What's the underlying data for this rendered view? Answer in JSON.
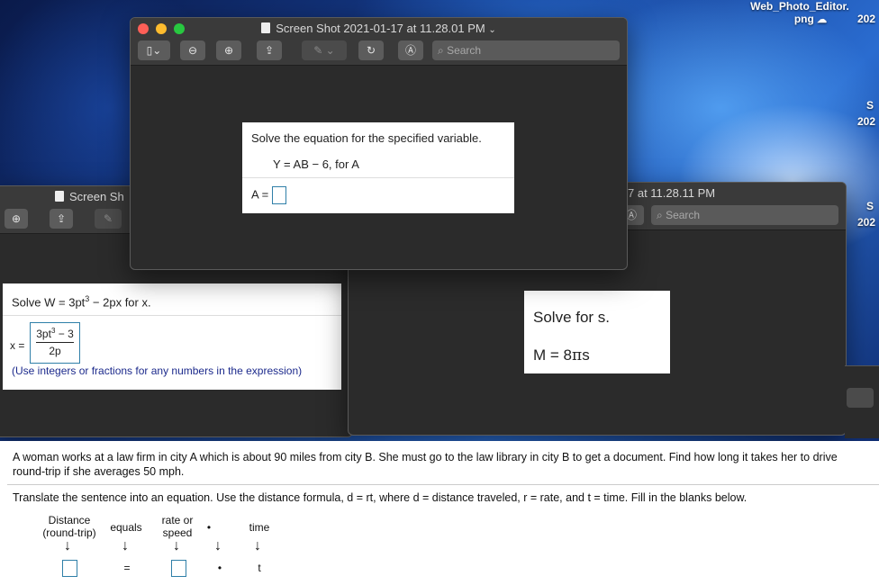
{
  "desktop": {
    "item1_name": "Web_Photo_Editor.",
    "item1_ext": "png",
    "edge_labels": [
      "202",
      "S",
      "202",
      "S",
      "202"
    ]
  },
  "window_front": {
    "title": "Screen Shot 2021-01-17 at 11.28.01 PM",
    "search_placeholder": "Search",
    "card": {
      "instruction": "Solve the equation for the specified variable.",
      "equation": "Y = AB − 6, for A",
      "answer_label": "A ="
    }
  },
  "window_left": {
    "title": "Screen Sh",
    "card": {
      "prompt_prefix": "Solve W = 3pt",
      "prompt_exp": "3",
      "prompt_suffix": " − 2px for x.",
      "x_label": "x =",
      "numerator_base": "3pt",
      "numerator_exp": "3",
      "numerator_tail": " − 3",
      "denominator": "2p",
      "note": "(Use integers or fractions for any numbers in the expression)"
    }
  },
  "window_right": {
    "title": "7 at 11.28.11 PM",
    "search_placeholder": "Search",
    "card": {
      "heading": "Solve for s.",
      "equation_prefix": "M = 8",
      "pi": "π",
      "equation_suffix": "s"
    }
  },
  "problem": {
    "text": "A woman works at a law firm in city A which is about 90 miles from city B. She must go to the law library in city B to get a document. Find how long it takes her to drive round-trip if she averages 50 mph.",
    "instruction": "Translate the sentence into an equation. Use the distance formula, d = rt, where d = distance traveled, r = rate, and t = time. Fill in the blanks below.",
    "columns": {
      "distance_1": "Distance",
      "distance_2": "(round-trip)",
      "equals": "equals",
      "rate_1": "rate or",
      "rate_2": "speed",
      "dot": "•",
      "time": "time"
    },
    "arrow": "↓",
    "answers": {
      "equals_sign": "=",
      "dot": "•",
      "t": "t"
    }
  },
  "colors": {
    "link_blue": "#1c2a8c",
    "box_border": "#2f7fa8",
    "window_bg": "#2b2b2b",
    "titlebar_bg": "#3a3a3a"
  }
}
